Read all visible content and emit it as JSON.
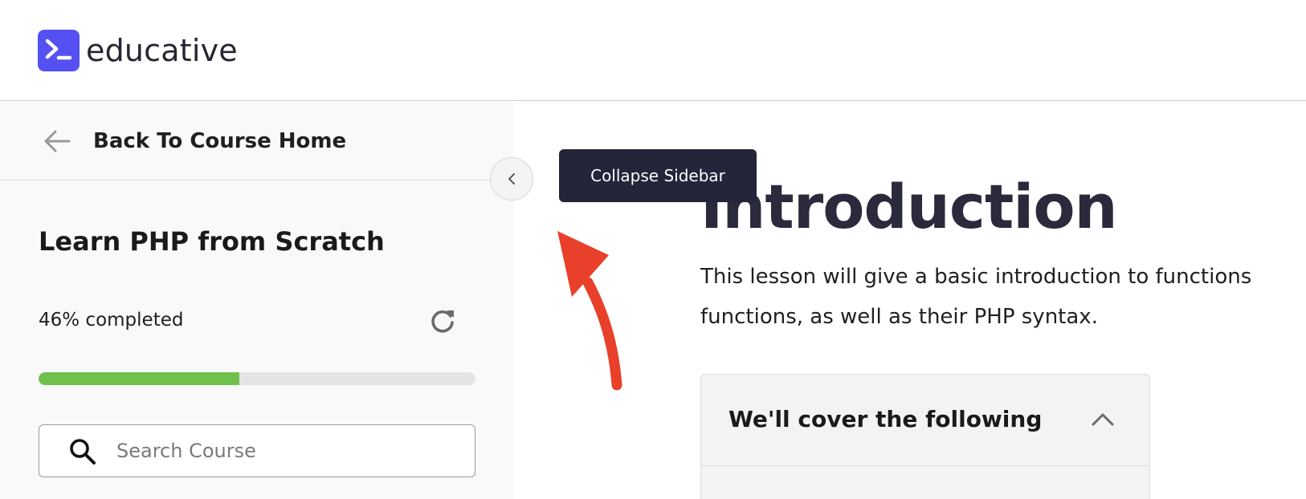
{
  "brand": {
    "name": "educative",
    "color": "#5550F2"
  },
  "sidebar": {
    "back_label": "Back To Course Home",
    "course_title": "Learn PHP from Scratch",
    "progress_label": "46% completed",
    "progress_percent": 46,
    "progress_color": "#70C14B",
    "search_placeholder": "Search Course"
  },
  "tooltip": {
    "text": "Collapse Sidebar"
  },
  "lesson": {
    "title": "Introduction",
    "description_line1": "This lesson will give a basic introduction to functions",
    "description_line2": "functions, as well as their PHP syntax."
  },
  "cover": {
    "title": "We'll cover the following"
  },
  "annotation": {
    "arrow_color": "#E8402A"
  },
  "icons": {
    "back": "arrow-left-icon",
    "refresh": "refresh-icon",
    "search": "search-icon",
    "collapse": "chevron-left-icon",
    "cover_toggle": "chevron-up-icon",
    "logo": "terminal-icon"
  }
}
